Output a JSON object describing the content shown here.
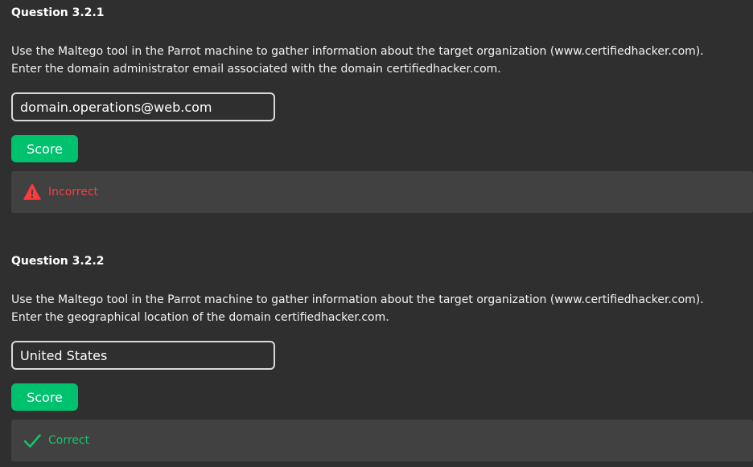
{
  "questions": [
    {
      "title": "Question 3.2.1",
      "text_lines": [
        "Use the Maltego tool in the Parrot machine to gather information about the target organization (www.certifiedhacker.com).",
        "Enter the domain administrator email associated with the domain certifiedhacker.com."
      ],
      "answer_value": "domain.operations@web.com",
      "score_label": "Score",
      "result": {
        "status": "incorrect",
        "label": "Incorrect",
        "icon": "warning-icon",
        "color": "#ff3b3b"
      }
    },
    {
      "title": "Question 3.2.2",
      "text_lines": [
        "Use the Maltego tool in the Parrot machine to gather information about the target organization (www.certifiedhacker.com).",
        "Enter the geographical location of the domain certifiedhacker.com."
      ],
      "answer_value": "United States",
      "score_label": "Score",
      "result": {
        "status": "correct",
        "label": "Correct",
        "icon": "checkmark-icon",
        "color": "#17c26c"
      }
    }
  ],
  "colors": {
    "background": "#2f2f2f",
    "result_panel": "#414141",
    "score_button": "#00c16e",
    "input_border": "#d9d9d9"
  }
}
